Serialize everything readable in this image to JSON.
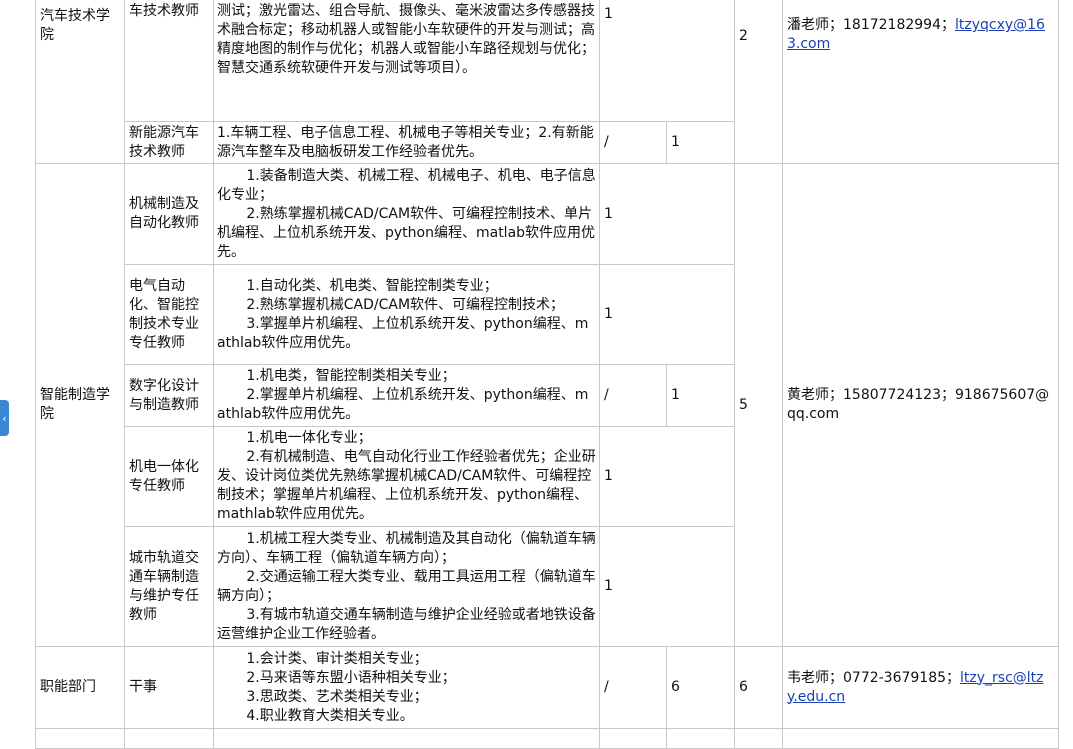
{
  "rows": {
    "auto": {
      "college": "汽车技术学院",
      "college_total": "2",
      "contact_prefix": "潘老师；18172182994；",
      "contact_email": "ltzyqcxy@163.com",
      "p1": {
        "position": "智能网联汽车技术教师",
        "req": [
          "不限于，底盘CAN协议的开发与测试；线控底盘系统开发与测试；激光雷达、组合导航、摄像头、毫米波雷达多传感器技术融合标定；移动机器人或智能小车软硬件的开发与测试；高精度地图的制作与优化；机器人或智能小车路径规划与优化；智慧交通系统软硬件开发与测试等项目）。"
        ],
        "count": "1"
      },
      "p2": {
        "position": "新能源汽车技术教师",
        "req": [
          "1.车辆工程、电子信息工程、机械电子等相关专业；2.有新能源汽车整车及电脑板研发工作经验者优先。"
        ],
        "count": "/",
        "count2": "1"
      }
    },
    "mfg": {
      "college": "智能制造学院",
      "col4": "/",
      "col5": "1",
      "college_total": "5",
      "contact": "黄老师；15807724123；918675607@qq.com",
      "p1": {
        "position": "机械制造及自动化教师",
        "req": [
          "1.装备制造大类、机械工程、机械电子、机电、电子信息化专业；",
          "2.熟练掌握机械CAD/CAM软件、可编程控制技术、单片机编程、上位机系统开发、python编程、matlab软件应用优先。"
        ],
        "count": "1"
      },
      "p2": {
        "position": "电气自动化、智能控制技术专业专任教师",
        "req": [
          "1.自动化类、机电类、智能控制类专业；",
          "2.熟练掌握机械CAD/CAM软件、可编程控制技术；",
          "3.掌握单片机编程、上位机系统开发、python编程、mathlab软件应用优先。"
        ],
        "count": "1"
      },
      "p3": {
        "position": "数字化设计与制造教师",
        "req": [
          "1.机电类，智能控制类相关专业；",
          "2.掌握单片机编程、上位机系统开发、python编程、mathlab软件应用优先。"
        ]
      },
      "p4": {
        "position": "机电一体化专任教师",
        "req": [
          "1.机电一体化专业；",
          "2.有机械制造、电气自动化行业工作经验者优先；企业研发、设计岗位类优先熟练掌握机械CAD/CAM软件、可编程控制技术；掌握单片机编程、上位机系统开发、python编程、mathlab软件应用优先。"
        ],
        "count": "1"
      },
      "p5": {
        "position": "城市轨道交通车辆制造与维护专任教师",
        "req": [
          "1.机械工程大类专业、机械制造及其自动化（偏轨道车辆方向）、车辆工程（偏轨道车辆方向）；",
          "2.交通运输工程大类专业、载用工具运用工程（偏轨道车辆方向）；",
          "3.有城市轨道交通车辆制造与维护企业经验或者地铁设备运营维护企业工作经验者。"
        ],
        "count": "1"
      }
    },
    "func": {
      "college": "职能部门",
      "position": "干事",
      "req": [
        "1.会计类、审计类相关专业；",
        "2.马来语等东盟小语种相关专业；",
        "3.思政类、艺术类相关专业；",
        "4.职业教育大类相关专业。"
      ],
      "col4": "/",
      "col5": "6",
      "college_total": "6",
      "contact_prefix": "韦老师；0772-3679185；",
      "contact_email": "ltzy_rsc@ltzy.edu.cn"
    }
  },
  "ui": {
    "side_handle_glyph": "‹",
    "side_handle_icon": "chevron-left-icon"
  }
}
